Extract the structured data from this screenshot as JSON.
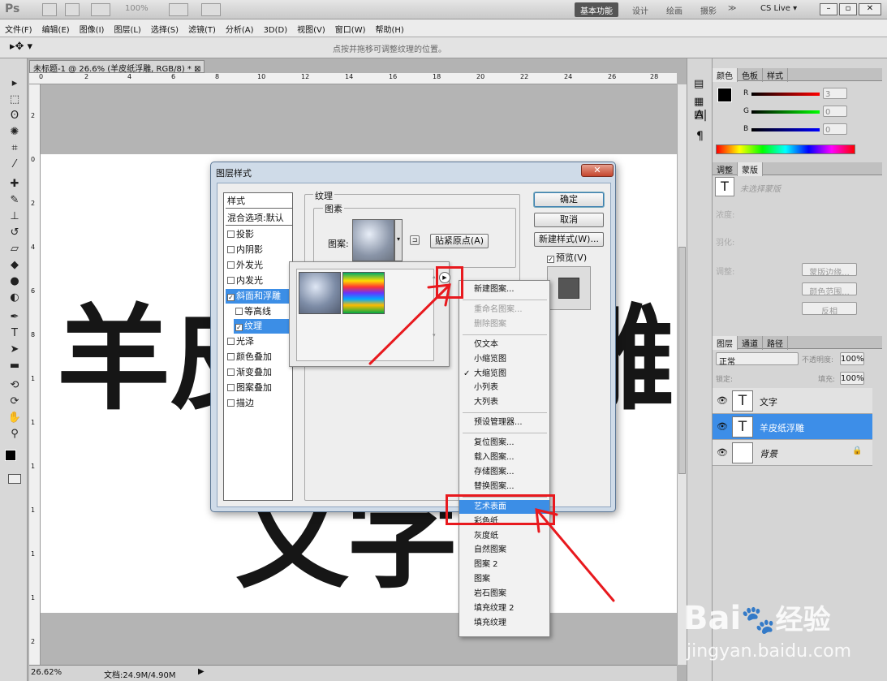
{
  "app": {
    "logo": "Ps",
    "zoom_display": "100%",
    "workspaces": [
      "基本功能",
      "设计",
      "绘画",
      "摄影"
    ],
    "more": "≫",
    "cs_live": "CS Live ▾",
    "hint": "点按并拖移可调整纹理的位置。"
  },
  "menu": [
    "文件(F)",
    "编辑(E)",
    "图像(I)",
    "图层(L)",
    "选择(S)",
    "滤镜(T)",
    "分析(A)",
    "3D(D)",
    "视图(V)",
    "窗口(W)",
    "帮助(H)"
  ],
  "document": {
    "tab": "未标题-1 @ 26.6% (羊皮纸浮雕, RGB/8) *",
    "canvas_text_top": "羊",
    "canvas_text_mid": "皮",
    "canvas_text_right": "雕",
    "canvas_text_bottom": "文字",
    "status_zoom": "26.62%",
    "status_doc": "文档:24.9M/4.90M",
    "ruler_marks": [
      "0",
      "2",
      "4",
      "6",
      "8",
      "10",
      "12",
      "14",
      "16",
      "18",
      "20",
      "22",
      "24",
      "26",
      "28"
    ],
    "vruler_marks": [
      "2",
      "0",
      "2",
      "4",
      "6",
      "8",
      "1",
      "1",
      "1",
      "1",
      "1",
      "1",
      "2"
    ]
  },
  "colors_panel": {
    "tabs": [
      "颜色",
      "色板",
      "样式"
    ],
    "r": "3",
    "g": "0",
    "b": "0",
    "r_label": "R",
    "g_label": "G",
    "b_label": "B"
  },
  "adjust_panel": {
    "tabs": [
      "调整",
      "蒙版"
    ],
    "mask_label": "未选择蒙版",
    "density": "浓度:",
    "feather": "羽化:",
    "refine": "调整:",
    "btn_edge": "蒙版边缘...",
    "btn_range": "颜色范围...",
    "btn_invert": "反相"
  },
  "layers_panel": {
    "tabs": [
      "图层",
      "通道",
      "路径"
    ],
    "blend": "正常",
    "opacity_label": "不透明度:",
    "opacity": "100%",
    "lock_label": "锁定:",
    "fill_label": "填充:",
    "fill": "100%",
    "layers": [
      {
        "name": "文字",
        "type": "T"
      },
      {
        "name": "羊皮纸浮雕",
        "type": "T"
      },
      {
        "name": "背景",
        "type": ""
      }
    ]
  },
  "dialog": {
    "title": "图层样式",
    "close": "✕",
    "styles_header": "样式",
    "blend_options": "混合选项:默认",
    "items": [
      {
        "label": "投影",
        "checked": false
      },
      {
        "label": "内阴影",
        "checked": false
      },
      {
        "label": "外发光",
        "checked": false
      },
      {
        "label": "内发光",
        "checked": false
      },
      {
        "label": "斜面和浮雕",
        "checked": true
      },
      {
        "label": "等高线",
        "checked": false
      },
      {
        "label": "纹理",
        "checked": true
      },
      {
        "label": "光泽",
        "checked": false
      },
      {
        "label": "颜色叠加",
        "checked": false
      },
      {
        "label": "渐变叠加",
        "checked": false
      },
      {
        "label": "图案叠加",
        "checked": false
      },
      {
        "label": "描边",
        "checked": false
      }
    ],
    "group_texture": "纹理",
    "group_pattern": "图素",
    "pattern_label": "图案:",
    "snap_btn": "贴紧原点(A)",
    "ok": "确定",
    "cancel": "取消",
    "new_style": "新建样式(W)...",
    "preview": "预览(V)"
  },
  "popup_menu": [
    {
      "label": "新建图案...",
      "state": "normal"
    },
    {
      "sep": true
    },
    {
      "label": "重命名图案...",
      "state": "disabled"
    },
    {
      "label": "删除图案",
      "state": "disabled"
    },
    {
      "sep": true
    },
    {
      "label": "仅文本",
      "state": "normal"
    },
    {
      "label": "小缩览图",
      "state": "normal"
    },
    {
      "label": "大缩览图",
      "state": "checked"
    },
    {
      "label": "小列表",
      "state": "normal"
    },
    {
      "label": "大列表",
      "state": "normal"
    },
    {
      "sep": true
    },
    {
      "label": "预设管理器...",
      "state": "normal"
    },
    {
      "sep": true
    },
    {
      "label": "复位图案...",
      "state": "normal"
    },
    {
      "label": "载入图案...",
      "state": "normal"
    },
    {
      "label": "存储图案...",
      "state": "normal"
    },
    {
      "label": "替换图案...",
      "state": "normal"
    },
    {
      "sep": true
    },
    {
      "label": "艺术表面",
      "state": "highlight"
    },
    {
      "label": "彩色纸",
      "state": "normal"
    },
    {
      "label": "灰度纸",
      "state": "normal"
    },
    {
      "label": "自然图案",
      "state": "normal"
    },
    {
      "label": "图案 2",
      "state": "normal"
    },
    {
      "label": "图案",
      "state": "normal"
    },
    {
      "label": "岩石图案",
      "state": "normal"
    },
    {
      "label": "填充纹理 2",
      "state": "normal"
    },
    {
      "label": "填充纹理",
      "state": "normal"
    }
  ],
  "watermark": {
    "brand": "Bai",
    "brand2": "经验",
    "url": "jingyan.baidu.com"
  },
  "accent": "#3c8ee6",
  "annotation_color": "#e8191e"
}
